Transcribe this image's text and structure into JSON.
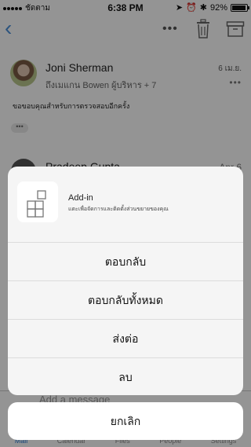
{
  "status_bar": {
    "carrier": "ชัดตาม",
    "time": "6:38 PM",
    "battery": "92%",
    "battery_level": 0.92
  },
  "nav": {
    "back_icon": "chevron-left-icon",
    "more_icon": "more-icon",
    "trash_icon": "trash-icon",
    "archive_icon": "archive-icon"
  },
  "message": {
    "sender": "Joni Sherman",
    "recipients": "ถึงเมแกน Bowen ผู้บริหาร + 7",
    "date": "6 เม.ย.",
    "body": "ขอขอบคุณสำหรับการตรวจสอบอีกครั้ง",
    "expand": "•••"
  },
  "second_message": {
    "sender": "Pradeep Gupta",
    "date": "Apr 6"
  },
  "compose": {
    "placeholder": "Add a message"
  },
  "tabs": [
    {
      "label": "Mail"
    },
    {
      "label": "Calendar"
    },
    {
      "label": "Files"
    },
    {
      "label": "People"
    },
    {
      "label": "Settings"
    }
  ],
  "sheet": {
    "addin_title": "Add-in",
    "addin_description": "แตะเพื่อจัดการและติดตั้งส่วนขยายของคุณ",
    "items": [
      {
        "label": "ตอบกลับ"
      },
      {
        "label": "ตอบกลับทั้งหมด"
      },
      {
        "label": "ส่งต่อ"
      },
      {
        "label": "ลบ"
      }
    ],
    "cancel": "ยกเลิก"
  },
  "colors": {
    "accent": "#4a90d9",
    "overlay": "#000000",
    "sheet_bg": "#f5f5f5"
  }
}
